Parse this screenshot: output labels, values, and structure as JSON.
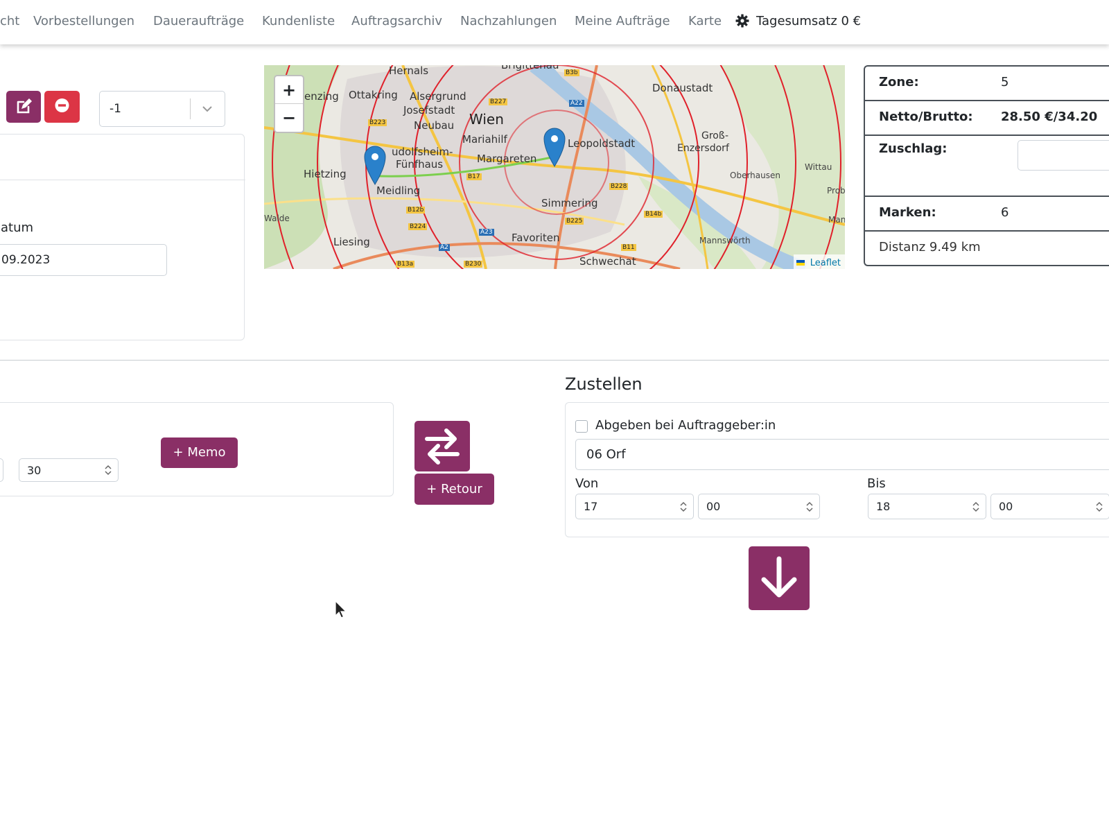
{
  "nav": {
    "items": [
      "cht",
      "Vorbestellungen",
      "Daueraufträge",
      "Kundenliste",
      "Auftragsarchiv",
      "Nachzahlungen",
      "Meine Aufträge",
      "Karte"
    ],
    "revenue": "Tagesumsatz 0 €"
  },
  "top": {
    "select_value": "-1",
    "date_label": "atum",
    "date_value": "09.2023"
  },
  "map": {
    "labels": [
      "Hernals",
      "Brigittenau",
      "enzing",
      "Ottakring",
      "Alsergrund",
      "Josefstadt",
      "Neubau",
      "Wien",
      "Donaustadt",
      "Mariahilf",
      "Leopoldstadt",
      "udolfsheim-",
      "Fünfhaus",
      "Margareten",
      "Groß-",
      "Enzersdorf",
      "Hietzing",
      "Oberhausen",
      "Wittau",
      "Meidling",
      "Simmering",
      "Walde",
      "Liesing",
      "Favoriten",
      "Mannswörth",
      "Schwechat",
      "Prob",
      "Man"
    ],
    "roads": [
      "B3b",
      "A22",
      "B227",
      "B223",
      "B17",
      "B228",
      "B12b",
      "B224",
      "B14b",
      "B225",
      "A23",
      "A2",
      "B11",
      "B13a",
      "B230"
    ],
    "attribution": "Leaflet",
    "zoom_in": "+",
    "zoom_out": "−"
  },
  "info": {
    "zone_label": "Zone:",
    "zone_value": "5",
    "netto_label": "Netto/Brutto:",
    "netto_value": "28.50 €/34.20",
    "zuschlag_label": "Zuschlag:",
    "marken_label": "Marken:",
    "marken_value": "6",
    "distanz": "Distanz 9.49 km"
  },
  "pickup": {
    "minute_value": "30",
    "memo_button": "+ Memo"
  },
  "middle": {
    "retour_button": "+ Retour"
  },
  "delivery": {
    "title": "Zustellen",
    "checkbox_label": "Abgeben bei Auftraggeber:in",
    "address_value": "06 Orf",
    "von_label": "Von",
    "von_hour": "17",
    "von_minute": "00",
    "bis_label": "Bis",
    "bis_hour": "18",
    "bis_minute": "00"
  },
  "colors": {
    "accent": "#8a2f66",
    "danger": "#dc3545"
  }
}
